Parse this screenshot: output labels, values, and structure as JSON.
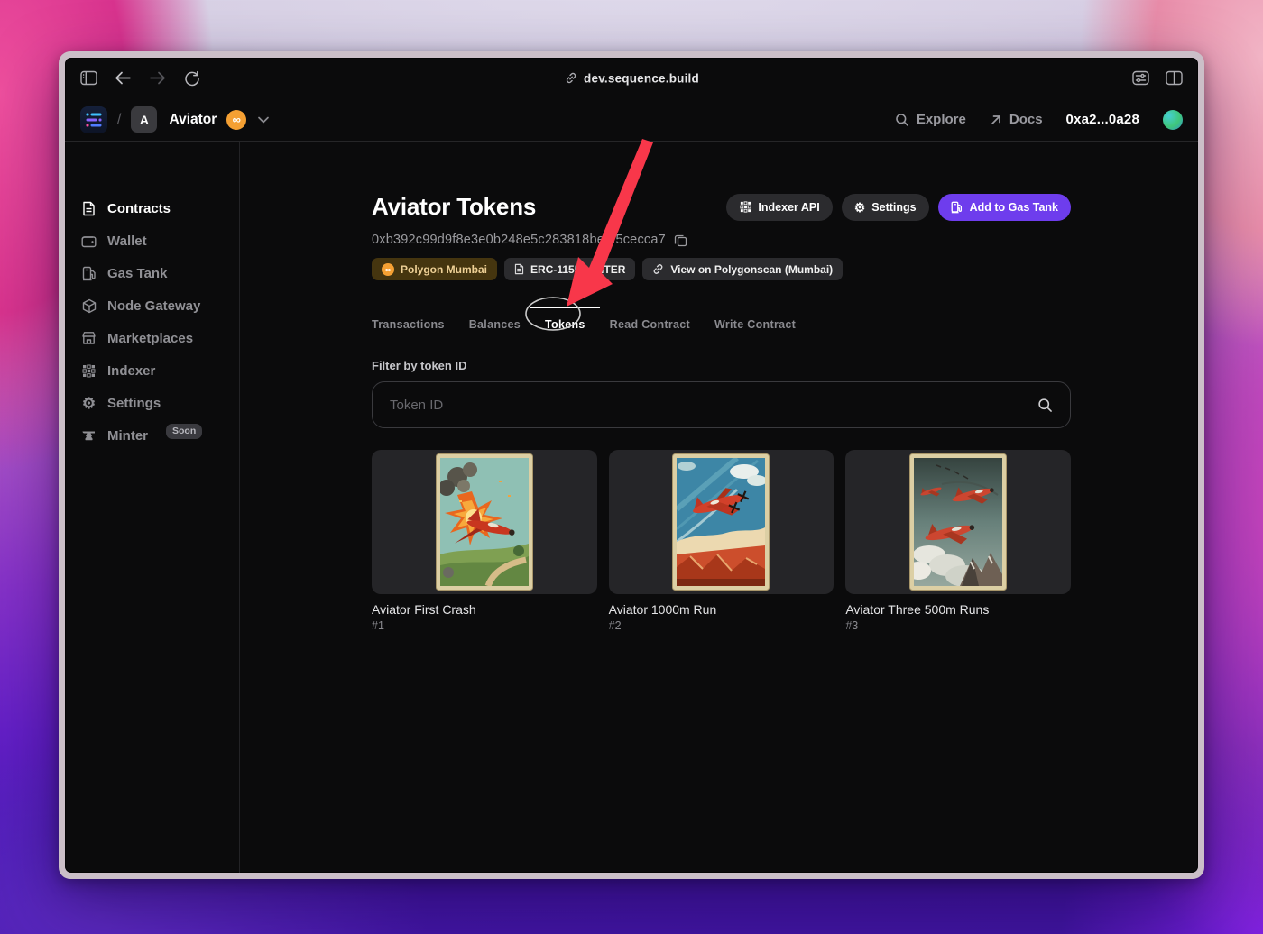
{
  "browser": {
    "url": "dev.sequence.build"
  },
  "header": {
    "breadcrumb_separator": "/",
    "project_initial": "A",
    "project_name": "Aviator",
    "nav": {
      "explore": "Explore",
      "docs": "Docs"
    },
    "wallet_address": "0xa2...0a28"
  },
  "icons": {
    "gear": "⚙",
    "infinity": "∞"
  },
  "sidebar": {
    "items": [
      {
        "label": "Contracts",
        "active": true
      },
      {
        "label": "Wallet"
      },
      {
        "label": "Gas Tank"
      },
      {
        "label": "Node Gateway"
      },
      {
        "label": "Marketplaces"
      },
      {
        "label": "Indexer"
      },
      {
        "label": "Settings"
      },
      {
        "label": "Minter",
        "badge": "Soon"
      }
    ]
  },
  "main": {
    "title": "Aviator Tokens",
    "contract_address": "0xb392c99d9f8e3e0b248e5c283818be0f5cecca7",
    "actions": {
      "indexer_api": "Indexer API",
      "settings": "Settings",
      "add_to_gas_tank": "Add to Gas Tank"
    },
    "badges": {
      "network": "Polygon Mumbai",
      "contract_type": "ERC-1155-MINTER",
      "explorer": "View on Polygonscan (Mumbai)"
    },
    "tabs": [
      {
        "label": "Transactions"
      },
      {
        "label": "Balances"
      },
      {
        "label": "Tokens",
        "active": true
      },
      {
        "label": "Read Contract"
      },
      {
        "label": "Write Contract"
      }
    ],
    "filter_label": "Filter by token ID",
    "token_id_placeholder": "Token ID",
    "tokens": [
      {
        "title": "Aviator First Crash",
        "token_id": "#1"
      },
      {
        "title": "Aviator 1000m Run",
        "token_id": "#2"
      },
      {
        "title": "Aviator Three 500m Runs",
        "token_id": "#3"
      }
    ]
  },
  "colors": {
    "accent_purple": "#6e3ded",
    "network_badge_bg": "#45350f",
    "network_badge_text": "#eed096",
    "polygon_orange": "#f5a033",
    "annotation_red": "#f8374a",
    "window_frame": "#cbbfc8"
  }
}
